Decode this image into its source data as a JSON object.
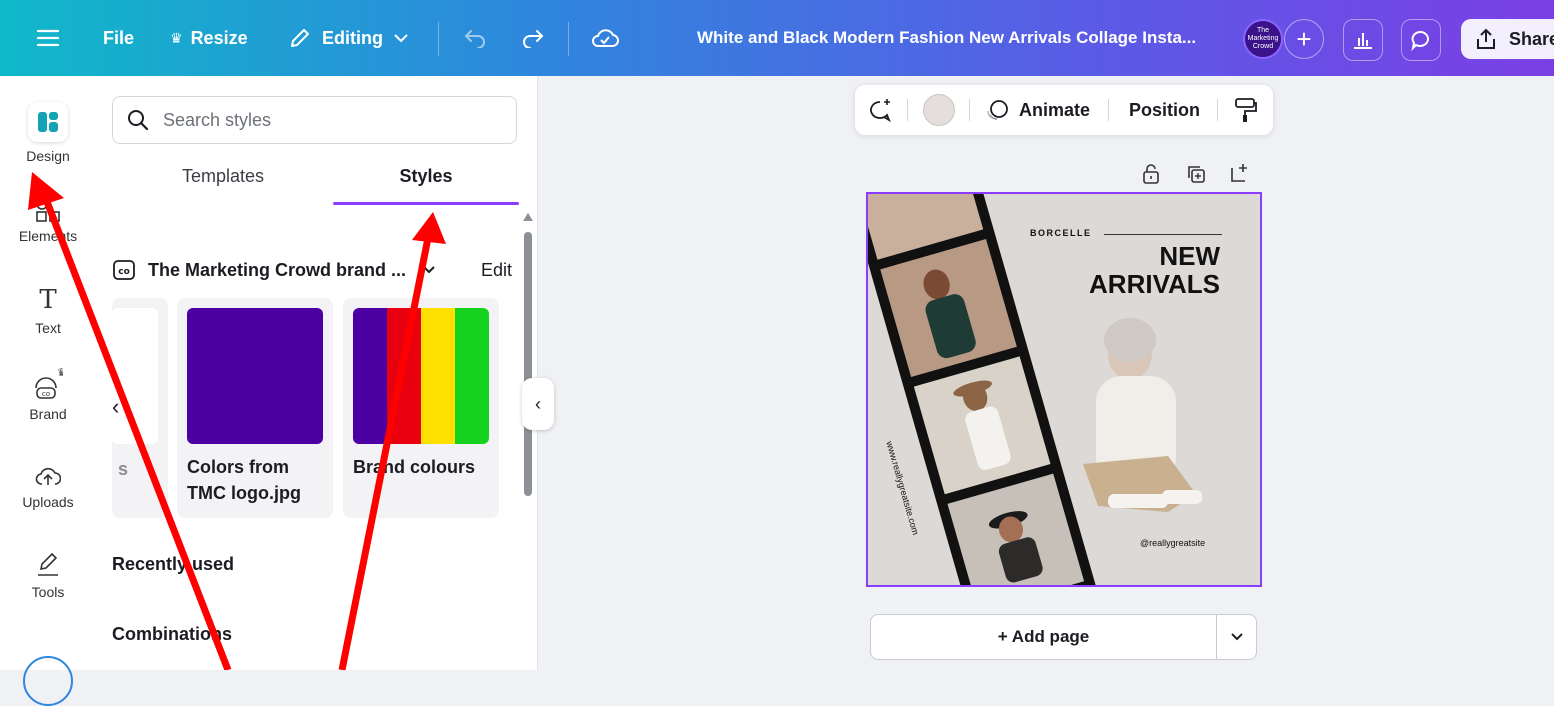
{
  "topbar": {
    "file_label": "File",
    "resize_label": "Resize",
    "editing_label": "Editing",
    "doc_title": "White and Black Modern Fashion New Arrivals Collage Insta...",
    "avatar_text": "The Marketing Crowd",
    "share_label": "Share"
  },
  "rail": {
    "items": [
      {
        "label": "Design"
      },
      {
        "label": "Elements"
      },
      {
        "label": "Text"
      },
      {
        "label": "Brand"
      },
      {
        "label": "Uploads"
      },
      {
        "label": "Tools"
      }
    ]
  },
  "panel": {
    "search": {
      "placeholder": "Search styles",
      "value": ""
    },
    "tabs": [
      {
        "label": "Templates"
      },
      {
        "label": "Styles",
        "active": true
      }
    ],
    "brand_kit": {
      "name": "The Marketing Crowd brand ...",
      "edit_label": "Edit"
    },
    "cards": [
      {
        "label": "s",
        "partial": true
      },
      {
        "label": "Colors from TMC logo.jpg",
        "line1": "Colors from",
        "line2": "TMC logo.jpg",
        "colors": [
          "#4a00a3"
        ]
      },
      {
        "label": "Brand colours",
        "colors": [
          "#4a00a3",
          "#e8000e",
          "#ffe000",
          "#14d21e"
        ]
      }
    ],
    "sections": [
      {
        "label": "Recently used"
      },
      {
        "label": "Combinations"
      }
    ]
  },
  "context_toolbar": {
    "animate_label": "Animate",
    "position_label": "Position",
    "color_swatch": "#e5dedc"
  },
  "design": {
    "brand": "BORCELLE",
    "headline_1": "NEW",
    "headline_2": "ARRIVALS",
    "website": "www.reallygreatsite.com",
    "handle": "@reallygreatsite"
  },
  "add_page": {
    "label": "+ Add page"
  },
  "colors": {
    "accent": "#8b3dff",
    "annotation_arrow": "#ff0000"
  }
}
